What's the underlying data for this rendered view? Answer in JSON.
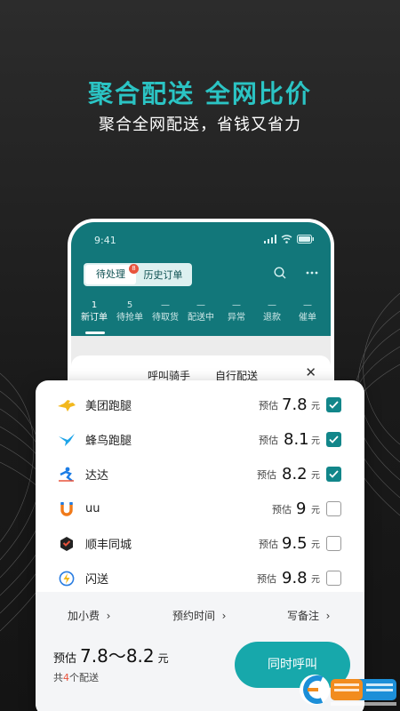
{
  "promo": {
    "headline": "聚合配送 全网比价",
    "subline": "聚合全网配送，省钱又省力"
  },
  "phone": {
    "status_time": "9:41",
    "segments": {
      "pending": "待处理",
      "pending_badge": "8",
      "history": "历史订单"
    },
    "tabs": [
      {
        "count": "1",
        "label": "新订单"
      },
      {
        "count": "5",
        "label": "待抢单"
      },
      {
        "count": "—",
        "label": "待取货"
      },
      {
        "count": "—",
        "label": "配送中"
      },
      {
        "count": "—",
        "label": "异常"
      },
      {
        "count": "—",
        "label": "退款"
      },
      {
        "count": "—",
        "label": "催单"
      }
    ],
    "sheet": {
      "tab_call": "呼叫骑手",
      "tab_self": "自行配送"
    }
  },
  "riders": [
    {
      "name": "美团跑腿",
      "est": "预估",
      "price": "7.8",
      "unit": "元",
      "checked": true,
      "icon": "kangaroo-icon",
      "color": "#f2b81d"
    },
    {
      "name": "蜂鸟跑腿",
      "est": "预估",
      "price": "8.1",
      "unit": "元",
      "checked": true,
      "icon": "bird-icon",
      "color": "#1ea4e8"
    },
    {
      "name": "达达",
      "est": "预估",
      "price": "8.2",
      "unit": "元",
      "checked": true,
      "icon": "runner-icon",
      "color": "#1c7de6"
    },
    {
      "name": "uu",
      "est": "预估",
      "price": "9",
      "unit": "元",
      "checked": false,
      "icon": "magnet-icon",
      "color": "#f07a1a"
    },
    {
      "name": "顺丰同城",
      "est": "预估",
      "price": "9.5",
      "unit": "元",
      "checked": false,
      "icon": "sf-icon",
      "color": "#222222"
    },
    {
      "name": "闪送",
      "est": "预估",
      "price": "9.8",
      "unit": "元",
      "checked": false,
      "icon": "lightning-icon",
      "color": "#2a7de1"
    }
  ],
  "footer": {
    "tip": "加小费",
    "schedule": "预约时间",
    "note": "写备注",
    "est_label": "预估",
    "est_range": "7.8～8.2",
    "est_unit": "元",
    "count_prefix": "共",
    "count": "4",
    "count_suffix": "个配送",
    "call_button": "同时呼叫"
  },
  "colors": {
    "accent": "#17a8ab",
    "teal_header": "#12777a",
    "headline": "#2bc4c4"
  }
}
